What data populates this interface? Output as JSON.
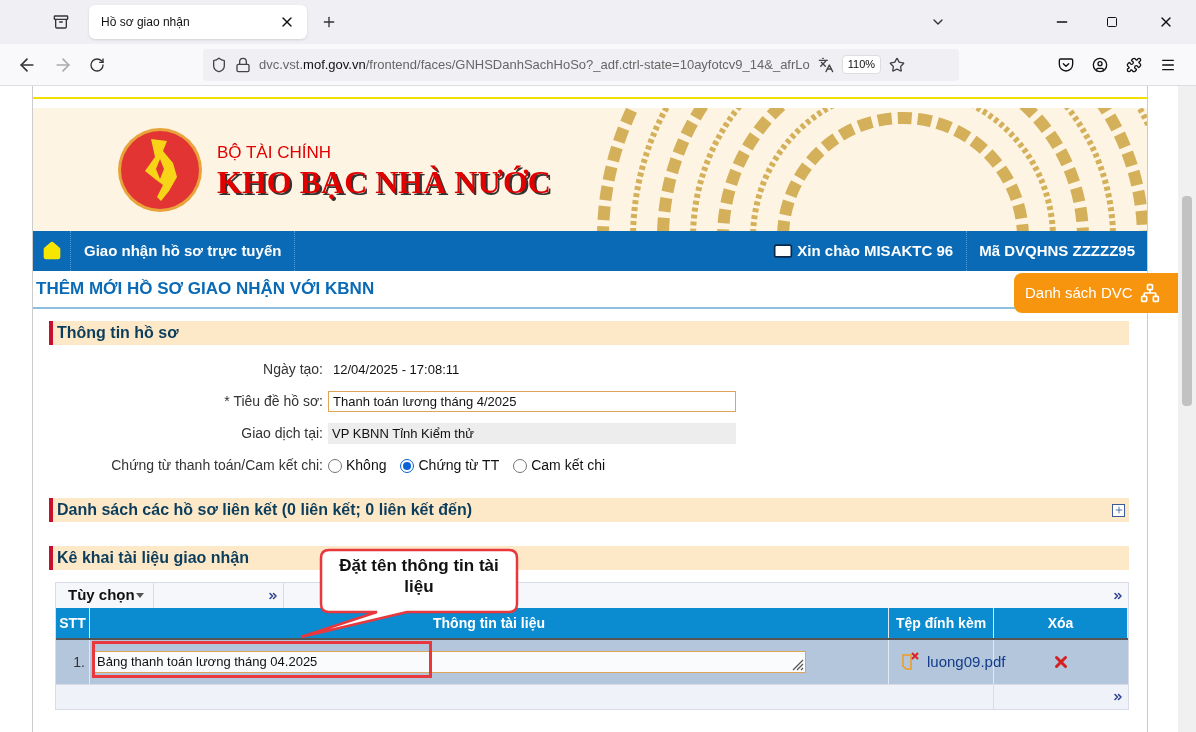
{
  "browser": {
    "tab_title": "Hồ sơ giao nhận",
    "url": "dvc.vst.**mof.gov.vn**/frontend/faces/GNHSDanhSachHoSo?_adf.ctrl-state=10ayfotcv9_14&_afrLo",
    "zoom": "110%"
  },
  "header": {
    "ministry": "BỘ TÀI CHÍNH",
    "agency": "KHO BẠC NHÀ NƯỚC"
  },
  "nav": {
    "items": [
      "Giao nhận hồ sơ trực tuyến"
    ],
    "greeting": "Xin chào MISAKTC 96",
    "unit": "Mã DVQHNS ZZZZZ95"
  },
  "float_button": "Danh sách DVC",
  "page_title": "THÊM MỚI HỒ SƠ GIAO NHẬN VỚI KBNN",
  "info_section": {
    "title": "Thông tin hồ sơ",
    "created": {
      "label": "Ngày tạo:",
      "value": "12/04/2025 - 17:08:11"
    },
    "record_title": {
      "label": "* Tiêu đề hồ sơ:",
      "value": "Thanh toán lương tháng 4/2025"
    },
    "transaction": {
      "label": "Giao dịch tại:",
      "value": "VP KBNN Tỉnh Kiểm thử"
    },
    "voucher": {
      "label": "Chứng từ thanh toán/Cam kết chi:",
      "options": [
        {
          "label": "Không",
          "selected": false
        },
        {
          "label": "Chứng từ TT",
          "selected": true
        },
        {
          "label": "Cam kết chi",
          "selected": false
        }
      ]
    }
  },
  "linked_section": {
    "title": "Danh sách các hồ sơ liên kết (0 liên kết; 0 liên kết đến)",
    "expanded": false
  },
  "documents_section": {
    "title": "Kê khai tài liệu giao nhận",
    "menu": "Tùy chọn",
    "columns": [
      "STT",
      "Thông tin tài liệu",
      "Tệp đính kèm",
      "Xóa"
    ],
    "rows": [
      {
        "stt": "1.",
        "info": "Bảng thanh toán lương tháng 04.2025",
        "file": "luong09.pdf",
        "highlighted": true
      }
    ]
  },
  "callout": "Đặt tên thông tin tài liệu"
}
